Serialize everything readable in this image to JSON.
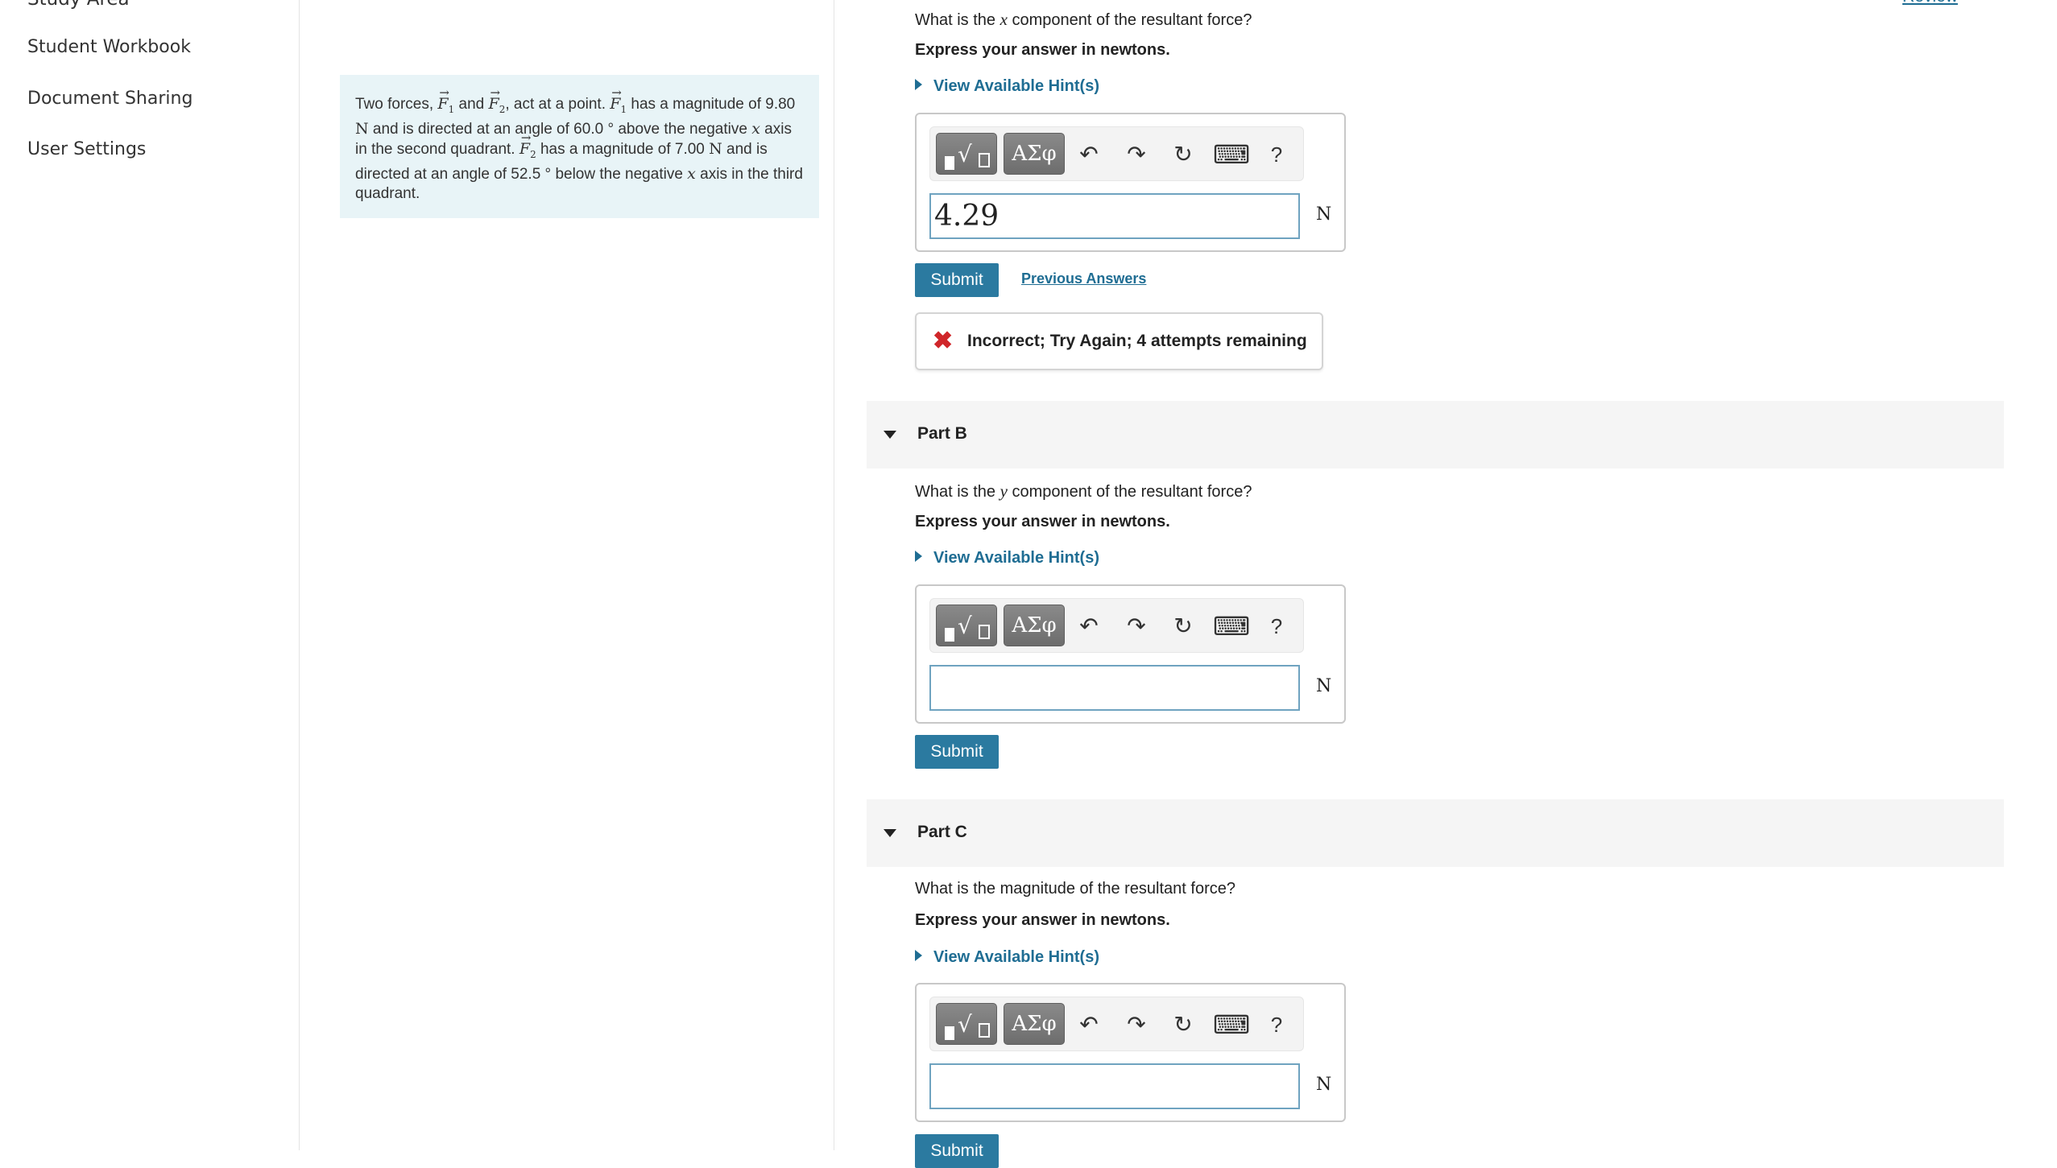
{
  "sidebar": {
    "cut_item": "Study Area",
    "items": [
      {
        "label": "Student Workbook"
      },
      {
        "label": "Document Sharing"
      },
      {
        "label": "User Settings"
      }
    ]
  },
  "header": {
    "review_label": "Review"
  },
  "problem": {
    "t1": "Two forces, ",
    "F": "F",
    "sub1": "1",
    "sub2": "2",
    "t_and": " and ",
    "t2": ", act at a point. ",
    "t3": " has a magnitude of 9.80 ",
    "unitN": "N",
    "t4": " and is directed at an angle of 60.0 ° above the negative ",
    "x": "x",
    "t5": " axis in the second quadrant. ",
    "t6": " has a magnitude of 7.00 ",
    "t7": " and is directed at an angle of 52.5 ° below the negative ",
    "t8": " axis in the third quadrant."
  },
  "partA": {
    "question_pre": "What is the ",
    "question_var": "x",
    "question_post": " component of the resultant force?",
    "express": "Express your answer in newtons.",
    "hint": "View Available Hint(s)",
    "input_value": "4.29",
    "unit": "N",
    "submit": "Submit",
    "previous": "Previous Answers",
    "feedback_icon": "✖",
    "feedback": "Incorrect; Try Again; 4 attempts remaining"
  },
  "partB": {
    "title": "Part B",
    "question_pre": "What is the ",
    "question_var": "y",
    "question_post": " component of the resultant force?",
    "express": "Express your answer in newtons.",
    "hint": "View Available Hint(s)",
    "input_value": "",
    "unit": "N",
    "submit": "Submit"
  },
  "partC": {
    "title": "Part C",
    "question": "What is the magnitude of the resultant force?",
    "express": "Express your answer in newtons.",
    "hint": "View Available Hint(s)",
    "input_value": "",
    "unit": "N",
    "submit": "Submit"
  },
  "toolbar": {
    "greek": "ΑΣφ",
    "radical": "√",
    "undo": "↶",
    "redo": "↷",
    "reset": "↻",
    "keyboard": "⌨",
    "help": "?"
  },
  "colors": {
    "accent": "#2b7aa0",
    "link": "#1f6d93",
    "error": "#d0262a",
    "problem_bg": "#e8f4f7"
  }
}
